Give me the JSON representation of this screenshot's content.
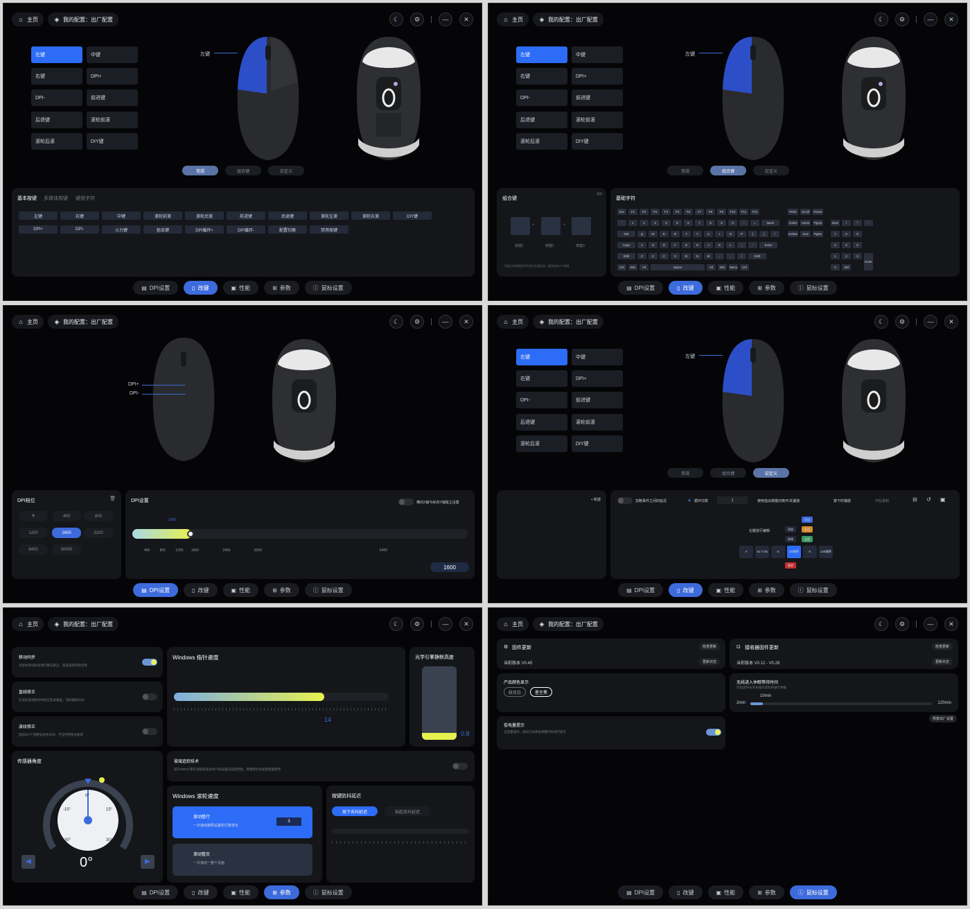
{
  "header": {
    "home": "主页",
    "profile": "我的配置：出厂配置"
  },
  "nav": [
    "DPI设置",
    "改键",
    "性能",
    "参数",
    "鼠标设置"
  ],
  "keys": {
    "left": "左键",
    "middle": "中键",
    "right": "右键",
    "dpi_up": "DPI+",
    "dpi_down": "DPI-",
    "forward": "前进键",
    "back": "后退键",
    "wheel_fwd": "滚轮前滚",
    "wheel_back": "滚轮后滚",
    "diy": "DIY键"
  },
  "callout_left": "左键",
  "modes": [
    "常规",
    "组合键",
    "宏定义"
  ],
  "p1": {
    "tabs": [
      "基本按键",
      "多媒体按键",
      "键盘字符"
    ],
    "row1": [
      "左键",
      "右键",
      "中键",
      "滚轮前滚",
      "滚轮后滚",
      "前进键",
      "后退键",
      "滚轮左滚",
      "滚轮右滚",
      "DIY键"
    ],
    "row2": [
      "DPI+",
      "DPI-",
      "火力键",
      "狙击键",
      "DPI循环+",
      "DPI循环-",
      "配置切换",
      "禁用按键"
    ]
  },
  "p2": {
    "combo_title": "组合键",
    "combo_labels": [
      "按键1",
      "按键2",
      "按键3"
    ],
    "combo_hint": "可通过右侧键盘字符进行任意组合，最多组合3个按键",
    "combo_clear": "清除",
    "basic_title": "基础字符",
    "frow": [
      "Esc",
      "F1",
      "F2",
      "F3",
      "F4",
      "F5",
      "F6",
      "F7",
      "F8",
      "F9",
      "F10",
      "F11",
      "F12"
    ],
    "nrow": [
      "`",
      "1",
      "2",
      "3",
      "4",
      "5",
      "6",
      "7",
      "8",
      "9",
      "0",
      "-",
      "=",
      "Back"
    ],
    "qrow": [
      "Tab",
      "Q",
      "W",
      "E",
      "R",
      "T",
      "Y",
      "U",
      "I",
      "O",
      "P",
      "[",
      "]",
      "\\"
    ],
    "arow": [
      "Caps",
      "A",
      "S",
      "D",
      "F",
      "G",
      "H",
      "J",
      "K",
      "L",
      ";",
      "'",
      "Enter"
    ],
    "zrow": [
      "Shift",
      "Z",
      "X",
      "C",
      "V",
      "B",
      "N",
      "M",
      ",",
      ".",
      "/",
      "Shift"
    ],
    "brow": [
      "Ctrl",
      "Win",
      "Alt",
      "Space",
      "Alt",
      "Win",
      "Menu",
      "Ctrl"
    ],
    "nav1": [
      "PrtSc",
      "Scroll",
      "Pause"
    ],
    "nav2": [
      "Insert",
      "Home",
      "PgUp"
    ],
    "nav3": [
      "Delete",
      "End",
      "PgDn"
    ],
    "num1": [
      "Num",
      "/",
      "*",
      "-"
    ],
    "num2": [
      "7",
      "8",
      "9"
    ],
    "num3": [
      "4",
      "5",
      "6"
    ],
    "num4": [
      "1",
      "2",
      "3"
    ],
    "num5": [
      "0",
      ".Del"
    ],
    "num_enter": "Enter"
  },
  "p3": {
    "dpi_up": "DPI+",
    "dpi_down": "DPI-",
    "levels_title": "DPI档位",
    "levels": [
      "400",
      "800",
      "1200",
      "1600",
      "3200",
      "6400",
      "30000"
    ],
    "settings_title": "DPI设置",
    "xy_label": "横向X轴与纵向Y轴独立设置",
    "current": "1600",
    "ticks": [
      "400",
      "800",
      "1200",
      "1600",
      "2400",
      "3200",
      "6400"
    ],
    "value": "1600"
  },
  "p4": {
    "new": "+ 新建",
    "opt1": "忽略事件之间的延迟",
    "opt2": "循环次数",
    "loop": "1",
    "opt3": "使用指派按键切换开/关播放",
    "opt4": "按下时播放",
    "opt5": "开始录制",
    "edit_label": "右键进行编辑",
    "menu": [
      "添加",
      "延迟",
      "修改",
      "全部",
      "删除"
    ],
    "steps": [
      "A",
      "X2 Y:45",
      "K",
      "26毫秒",
      "K",
      "146毫秒"
    ]
  },
  "p5": {
    "sync": "移动同步",
    "sync_desc": "对鼠标移动轨迹进行算法修正，提高追踪的稳定性",
    "straight": "直线修正",
    "straight_desc": "在鼠标直线移动时修正轨迹偏差，消除偏移抖动",
    "ripple": "波纹修正",
    "ripple_desc": "鼠标DPI下调整波纹失抖动，不宜控制移动速度",
    "pointer_title": "Windows 指针速度",
    "pointer_value": "14",
    "lod_title": "光学引擎静默高度",
    "lod_value": "0.8",
    "angle_title": "传感器角度",
    "angle_value": "0°",
    "angle_ticks": [
      "0°",
      "-15°",
      "15°",
      "-30°",
      "30°"
    ],
    "glass": "玻璃追踪技术",
    "glass_desc": "提升3950引擎在玻璃等高反射介质表面的追踪性能，需要配合高质量镜面使用",
    "scroll_title": "Windows 滚轮速度",
    "scroll1": "滚动整行",
    "scroll1_desc": "一次滚动按照设置的行数变化",
    "scroll_lines": "3",
    "scroll2": "滚动整页",
    "scroll2_desc": "一次滚动一整个页面",
    "debounce_title": "按键防抖延迟",
    "deb1": "按下去抖延迟",
    "deb2": "抬起去抖延迟"
  },
  "p6": {
    "fw": "固件更新",
    "fw_check": "检查更新",
    "fw_ver": "当前版本 V0.45",
    "fw_log": "更新日志",
    "rx": "接收器固件更新",
    "rx_check": "检查更新",
    "rx_ver": "当前版本 V0.12 - V0.28",
    "rx_log": "更新日志",
    "color_title": "产品颜色显示",
    "colors": [
      "皎月白",
      "星空黑"
    ],
    "sleep_title": "无线进入休眠等待时间",
    "sleep_desc": "在指定时长内未操作鼠标将进行休眠",
    "sleep_value": "10min",
    "sleep_min": "2min",
    "sleep_max": "120min",
    "reset": "恢复出厂设置",
    "battery_title": "低电量提示",
    "battery_desc": "当电量低时，鼠标灯效将会频繁闪烁进行提示"
  },
  "colors": {
    "accent": "#2d6cf6",
    "yellow": "#e6f04e",
    "panel": "#141619"
  }
}
